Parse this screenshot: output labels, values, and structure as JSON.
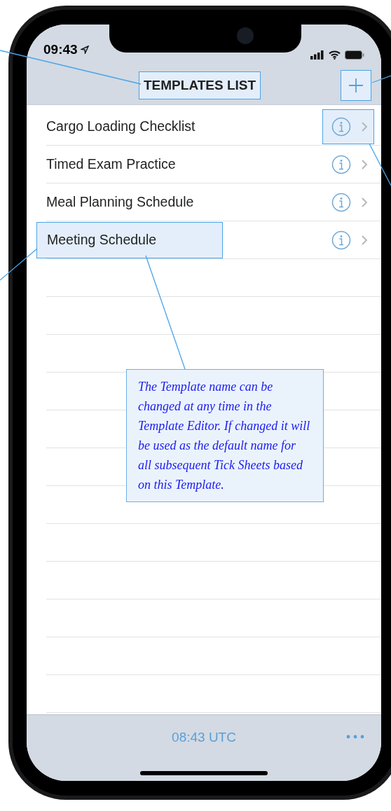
{
  "status_bar": {
    "time": "09:43"
  },
  "nav_bar": {
    "title": "TEMPLATES LIST",
    "title_highlighted": true,
    "add_highlighted": true
  },
  "templates": [
    {
      "name": "Cargo Loading Checklist",
      "name_highlighted": false,
      "info_highlighted": true
    },
    {
      "name": "Timed Exam Practice",
      "name_highlighted": false,
      "info_highlighted": false
    },
    {
      "name": "Meal Planning Schedule",
      "name_highlighted": false,
      "info_highlighted": false
    },
    {
      "name": "Meeting Schedule",
      "name_highlighted": true,
      "info_highlighted": false
    }
  ],
  "callout": {
    "text": "The Template name can be changed at any time in the Template Editor. If changed it will be used as the default name for all subsequent Tick Sheets based on this Template."
  },
  "toolbar": {
    "time": "08:43 UTC"
  }
}
